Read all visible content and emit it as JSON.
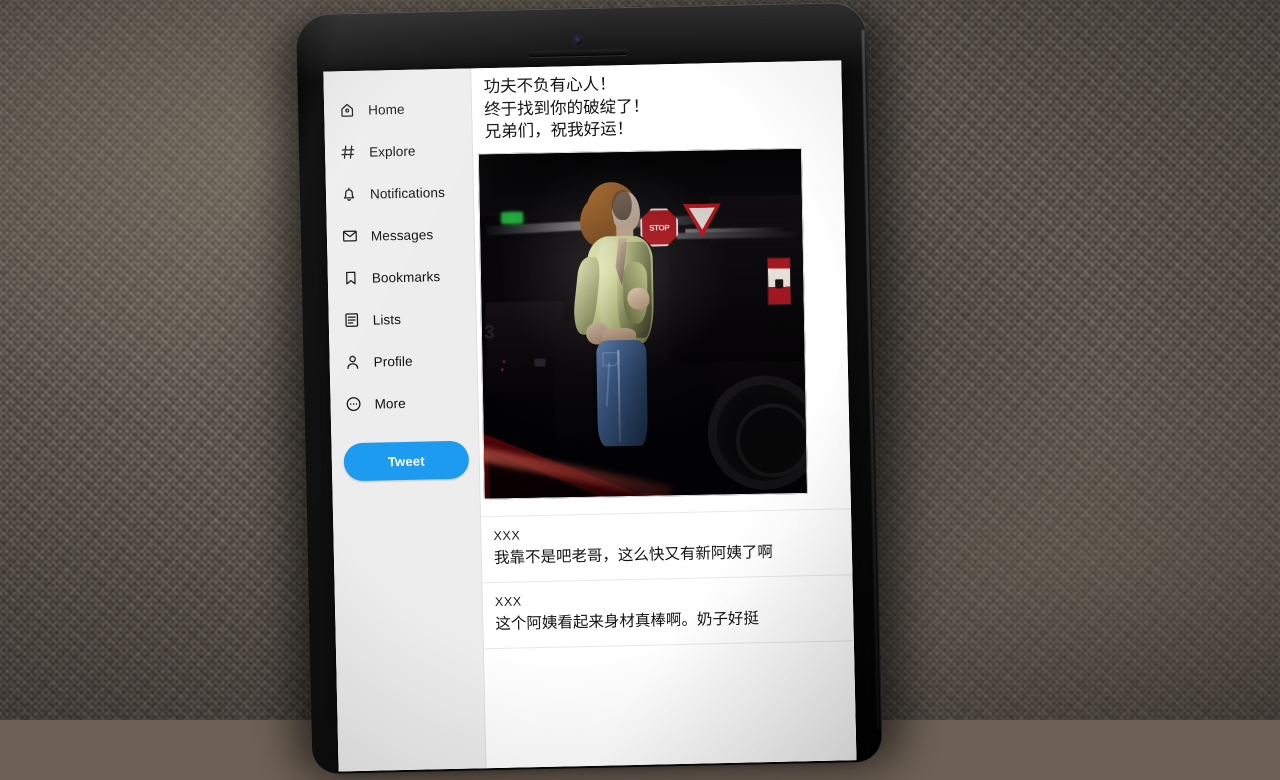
{
  "scene": {
    "surface": "woven-fabric",
    "device": "black-bezel-tablet"
  },
  "sidebar": {
    "items": [
      {
        "icon": "home-icon",
        "label": "Home"
      },
      {
        "icon": "hashtag-icon",
        "label": "Explore"
      },
      {
        "icon": "bell-icon",
        "label": "Notifications"
      },
      {
        "icon": "envelope-icon",
        "label": "Messages"
      },
      {
        "icon": "bookmark-icon",
        "label": "Bookmarks"
      },
      {
        "icon": "list-icon",
        "label": "Lists"
      },
      {
        "icon": "person-icon",
        "label": "Profile"
      },
      {
        "icon": "ellipsis-icon",
        "label": "More"
      }
    ],
    "compose_button": {
      "label": "Tweet",
      "color": "#1d9bf0",
      "text_color": "#ffffff"
    },
    "background_color": "#ededed"
  },
  "tweet": {
    "lines": [
      "功夫不负有心人！",
      "终于找到你的破绽了！",
      "兄弟们，祝我好运！"
    ],
    "media": {
      "type": "photo",
      "description": "dark parking garage scene",
      "signs": {
        "stop": "STOP",
        "yield": "YIELD"
      },
      "level_number": "3"
    }
  },
  "replies": [
    {
      "user": "XXX",
      "text": "我靠不是吧老哥，这么快又有新阿姨了啊"
    },
    {
      "user": "XXX",
      "text": "这个阿姨看起来身材真棒啊。奶子好挺"
    }
  ],
  "colors": {
    "accent": "#1d9bf0",
    "sidebar_bg": "#ededed",
    "content_bg": "#ffffff",
    "text": "#121212",
    "divider": "#e8e8e8"
  }
}
